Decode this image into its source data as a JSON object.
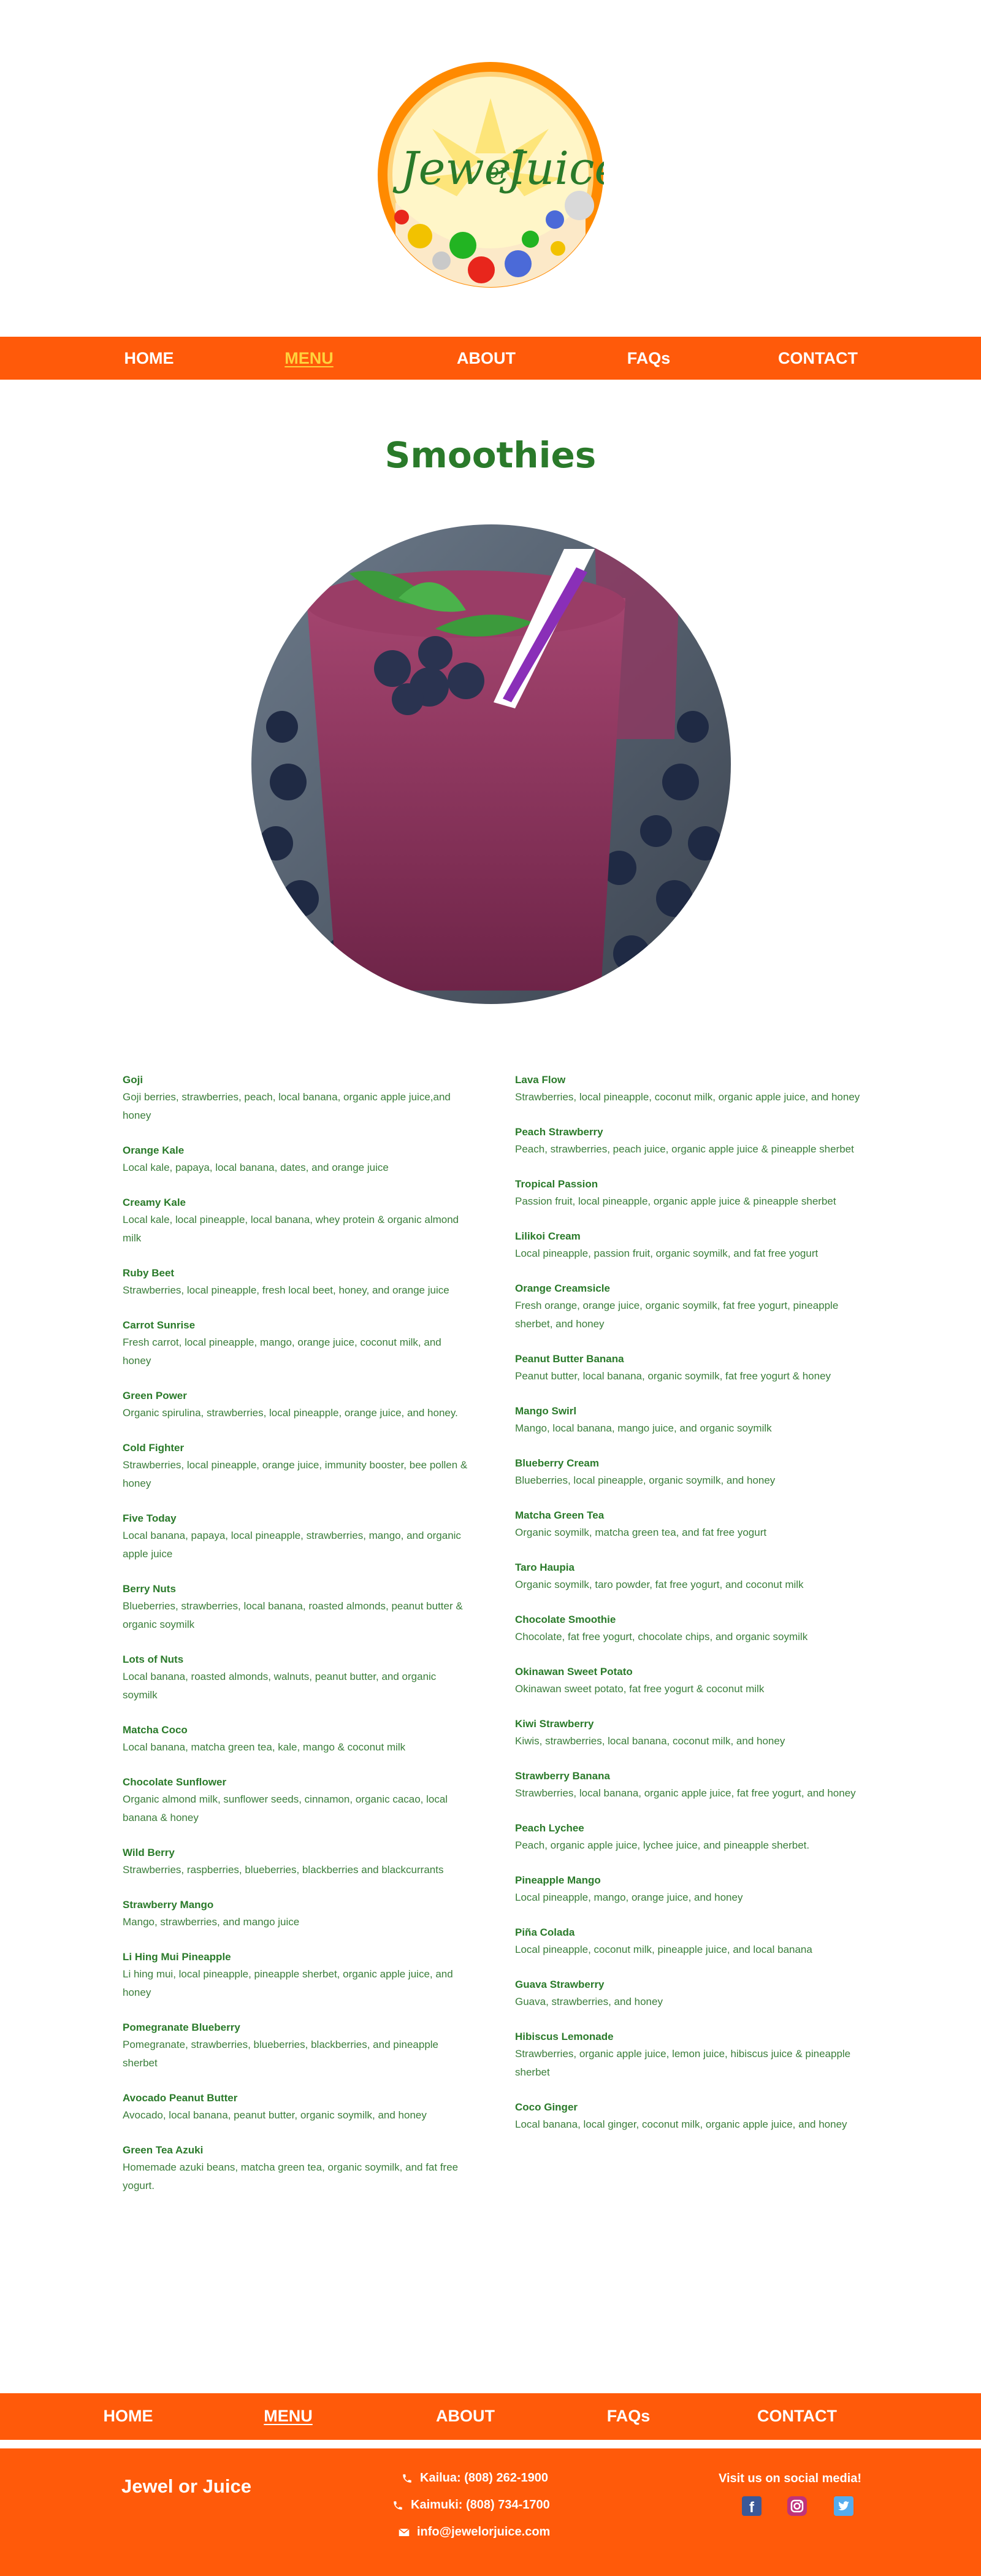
{
  "logo": {
    "word1": "Jewel",
    "word2": "or",
    "word3": "Juice"
  },
  "nav": {
    "home": "HOME",
    "menu": "MENU",
    "about": "ABOUT",
    "faqs": "FAQs",
    "contact": "CONTACT"
  },
  "page": {
    "title": "Smoothies"
  },
  "menu_left": [
    {
      "name": "Goji",
      "desc": "Goji berries, strawberries, peach, local banana, organic apple juice,and honey"
    },
    {
      "name": "Orange Kale",
      "desc": "Local kale, papaya, local banana, dates, and orange juice"
    },
    {
      "name": "Creamy Kale",
      "desc": "Local kale, local pineapple, local banana, whey protein & organic almond milk"
    },
    {
      "name": "Ruby Beet",
      "desc": "Strawberries, local pineapple, fresh local beet, honey, and orange juice"
    },
    {
      "name": "Carrot Sunrise",
      "desc": "Fresh carrot, local pineapple, mango, orange juice, coconut milk, and honey"
    },
    {
      "name": "Green Power",
      "desc": "Organic spirulina, strawberries, local pineapple, orange juice, and honey."
    },
    {
      "name": "Cold Fighter",
      "desc": "Strawberries, local pineapple, orange juice, immunity booster, bee pollen & honey"
    },
    {
      "name": "Five Today",
      "desc": "Local banana, papaya, local pineapple, strawberries, mango, and organic apple juice"
    },
    {
      "name": "Berry Nuts",
      "desc": "Blueberries, strawberries, local banana, roasted almonds, peanut butter & organic soymilk"
    },
    {
      "name": "Lots of Nuts",
      "desc": "Local banana, roasted almonds, walnuts, peanut butter, and organic soymilk"
    },
    {
      "name": "Matcha Coco",
      "desc": "Local banana, matcha green tea, kale, mango & coconut milk"
    },
    {
      "name": "Chocolate Sunflower",
      "desc": "Organic almond milk, sunflower seeds, cinnamon, organic cacao, local banana & honey"
    },
    {
      "name": "Wild Berry",
      "desc": "Strawberries, raspberries, blueberries, blackberries and blackcurrants"
    },
    {
      "name": "Strawberry Mango",
      "desc": "Mango, strawberries, and mango juice"
    },
    {
      "name": "Li Hing Mui Pineapple",
      "desc": "Li hing mui, local pineapple, pineapple sherbet, organic apple juice, and honey"
    },
    {
      "name": "Pomegranate Blueberry",
      "desc": "Pomegranate, strawberries, blueberries, blackberries, and pineapple sherbet"
    },
    {
      "name": "Avocado Peanut Butter",
      "desc": "Avocado, local banana, peanut butter, organic soymilk, and honey"
    },
    {
      "name": "Green Tea Azuki",
      "desc": "Homemade azuki beans, matcha green tea, organic soymilk, and fat free yogurt."
    }
  ],
  "menu_right": [
    {
      "name": "Lava Flow",
      "desc": "Strawberries, local pineapple, coconut milk, organic apple juice, and honey"
    },
    {
      "name": "Peach Strawberry",
      "desc": "Peach, strawberries, peach juice, organic apple juice & pineapple sherbet"
    },
    {
      "name": "Tropical Passion",
      "desc": "Passion fruit, local pineapple, organic apple juice & pineapple sherbet"
    },
    {
      "name": "Lilikoi Cream",
      "desc": "Local pineapple, passion fruit, organic soymilk, and fat free yogurt"
    },
    {
      "name": "Orange Creamsicle",
      "desc": "Fresh orange, orange juice, organic soymilk, fat free yogurt, pineapple sherbet, and honey"
    },
    {
      "name": "Peanut Butter Banana",
      "desc": "Peanut butter, local banana, organic soymilk, fat free yogurt & honey"
    },
    {
      "name": "Mango Swirl",
      "desc": "Mango, local banana, mango juice, and organic soymilk"
    },
    {
      "name": "Blueberry Cream",
      "desc": "Blueberries, local pineapple, organic soymilk, and honey"
    },
    {
      "name": "Matcha Green Tea",
      "desc": "Organic soymilk, matcha green tea, and fat free yogurt"
    },
    {
      "name": "Taro Haupia",
      "desc": "Organic soymilk, taro powder, fat free yogurt, and coconut milk"
    },
    {
      "name": "Chocolate Smoothie",
      "desc": "Chocolate, fat free yogurt, chocolate chips, and organic soymilk"
    },
    {
      "name": "Okinawan Sweet Potato",
      "desc": "Okinawan sweet potato, fat free yogurt & coconut milk"
    },
    {
      "name": "Kiwi Strawberry",
      "desc": "Kiwis, strawberries, local banana, coconut milk, and honey"
    },
    {
      "name": "Strawberry Banana",
      "desc": "Strawberries, local banana, organic apple juice, fat free yogurt, and honey"
    },
    {
      "name": "Peach Lychee",
      "desc": "Peach, organic apple juice, lychee juice, and pineapple sherbet."
    },
    {
      "name": "Pineapple Mango",
      "desc": "Local pineapple, mango, orange juice, and honey"
    },
    {
      "name": "Piña Colada",
      "desc": "Local pineapple, coconut milk, pineapple juice, and local banana"
    },
    {
      "name": "Guava Strawberry",
      "desc": "Guava, strawberries, and honey"
    },
    {
      "name": "Hibiscus Lemonade",
      "desc": "Strawberries, organic apple juice, lemon juice, hibiscus juice & pineapple sherbet"
    },
    {
      "name": "Coco Ginger",
      "desc": "Local banana, local ginger, coconut milk, organic apple juice, and honey"
    }
  ],
  "footer": {
    "brand": "Jewel or Juice",
    "kailua": "Kailua: (808) 262-1900",
    "kaimuki": "Kaimuki: (808) 734-1700",
    "email": "info@jewelorjuice.com",
    "social_title": "Visit us on social media!"
  },
  "colors": {
    "nav": "#ff5a0a",
    "active": "#ffd23c",
    "green": "#2a7a2a"
  }
}
